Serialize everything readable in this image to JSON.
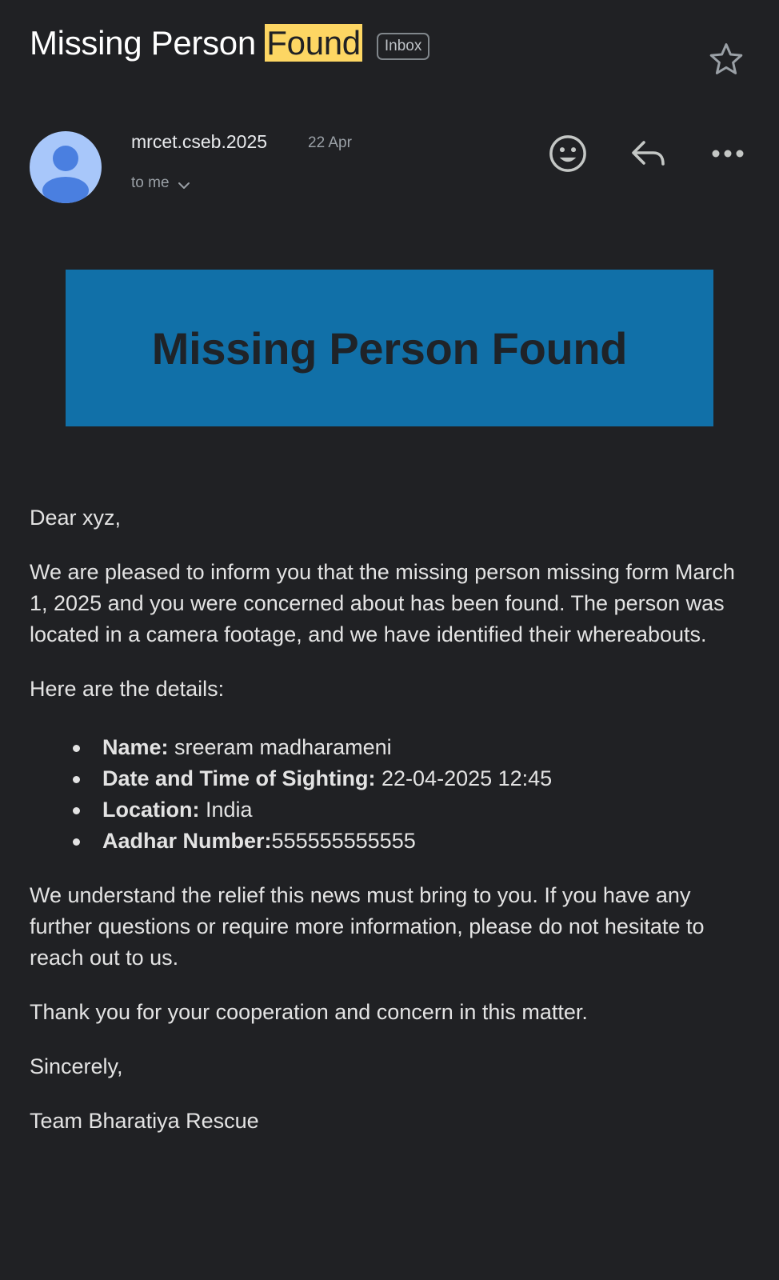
{
  "email": {
    "subject_main": "Missing Person ",
    "subject_highlight": "Found",
    "badge": "Inbox",
    "sender": "mrcet.cseb.2025",
    "date": "22 Apr",
    "recipient": "to me",
    "icons": {
      "star": "star-icon",
      "avatar": "person-icon",
      "emoji": "emoji-icon",
      "reply": "reply-icon",
      "more": "more-horizontal-icon",
      "chevron": "chevron-down-icon"
    }
  },
  "banner": {
    "title": "Missing Person Found",
    "background": "#1170a8"
  },
  "body": {
    "greeting": "Dear xyz,",
    "paragraph1": "We are pleased to inform you that the missing person missing form March 1, 2025 and you were concerned about has been found. The person was located in a camera footage, and we have identified their whereabouts.",
    "details_intro": "Here are the details:",
    "details": [
      {
        "label": "Name:",
        "value": " sreeram madharameni"
      },
      {
        "label": "Date and Time of Sighting:",
        "value": " 22-04-2025 12:45"
      },
      {
        "label": "Location:",
        "value": " India"
      },
      {
        "label": "Aadhar Number:",
        "value": "555555555555"
      }
    ],
    "paragraph2": "We understand the relief this news must bring to you. If you have any further questions or require more information, please do not hesitate to reach out to us.",
    "paragraph3": "Thank you for your cooperation and concern in this matter.",
    "closing": "Sincerely,",
    "signature": "Team Bharatiya Rescue"
  },
  "colors": {
    "background": "#202124",
    "highlight": "#fdd663",
    "avatar": "#a8c7fa"
  }
}
